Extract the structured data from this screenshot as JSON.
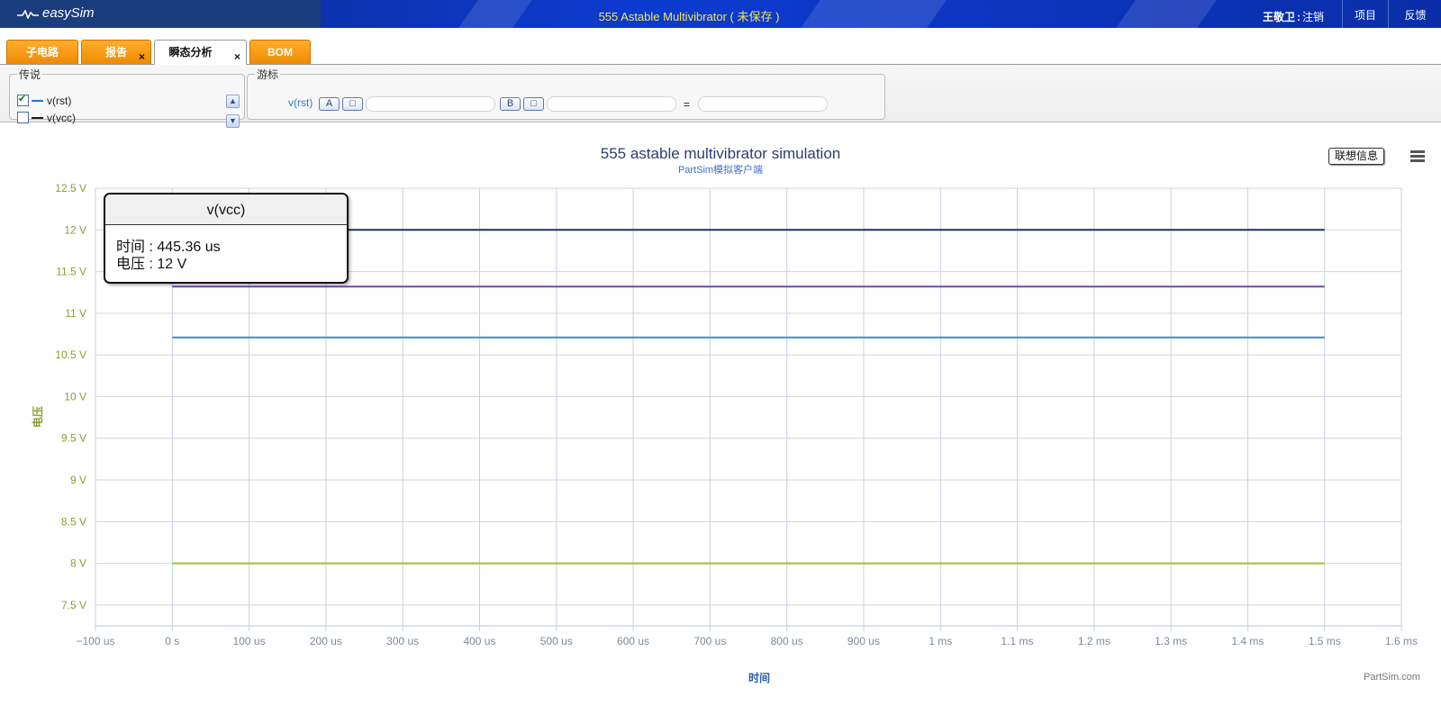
{
  "header": {
    "app_name": "easySim",
    "title": "555 Astable Multivibrator ( 未保存 )",
    "user_name": "王敬卫",
    "user_sep": ":",
    "logout": "注销",
    "projects": "项目",
    "feedback": "反馈"
  },
  "tabs": [
    {
      "label": "子电路",
      "closable": false,
      "active": false
    },
    {
      "label": "报告",
      "closable": true,
      "active": false
    },
    {
      "label": "瞬态分析",
      "closable": true,
      "active": true
    },
    {
      "label": "BOM",
      "closable": false,
      "active": false
    }
  ],
  "tab_close_glyph": "×",
  "legend_panel": {
    "title": "传说",
    "items": [
      {
        "label": "v(rst)",
        "checked": true,
        "color": "#2b6ed0"
      },
      {
        "label": "v(vcc)",
        "checked": false,
        "color": "#1a1a1a"
      }
    ]
  },
  "cursor_panel": {
    "title": "游标",
    "signal": "v(rst)",
    "a_button": "A",
    "b_button": "B",
    "small_button": "□",
    "equals": "=",
    "a_value": "",
    "b_value": "",
    "diff_value": ""
  },
  "chart_data": {
    "type": "line",
    "title": "555 astable multivibrator simulation",
    "subtitle": "PartSim模拟客户端",
    "xlabel": "时间",
    "ylabel": "电压",
    "xlim": [
      -100,
      1600
    ],
    "ylim": [
      7.25,
      12.5
    ],
    "x_ticks": [
      {
        "v": -100,
        "label": "−100 us"
      },
      {
        "v": 0,
        "label": "0 s"
      },
      {
        "v": 100,
        "label": "100 us"
      },
      {
        "v": 200,
        "label": "200 us"
      },
      {
        "v": 300,
        "label": "300 us"
      },
      {
        "v": 400,
        "label": "400 us"
      },
      {
        "v": 500,
        "label": "500 us"
      },
      {
        "v": 600,
        "label": "600 us"
      },
      {
        "v": 700,
        "label": "700 us"
      },
      {
        "v": 800,
        "label": "800 us"
      },
      {
        "v": 900,
        "label": "900 us"
      },
      {
        "v": 1000,
        "label": "1 ms"
      },
      {
        "v": 1100,
        "label": "1.1 ms"
      },
      {
        "v": 1200,
        "label": "1.2 ms"
      },
      {
        "v": 1300,
        "label": "1.3 ms"
      },
      {
        "v": 1400,
        "label": "1.4 ms"
      },
      {
        "v": 1500,
        "label": "1.5 ms"
      },
      {
        "v": 1600,
        "label": "1.6 ms"
      }
    ],
    "y_ticks": [
      {
        "v": 12.5,
        "label": "12.5 V"
      },
      {
        "v": 12,
        "label": "12 V"
      },
      {
        "v": 11.5,
        "label": "11.5 V"
      },
      {
        "v": 11,
        "label": "11 V"
      },
      {
        "v": 10.5,
        "label": "10.5 V"
      },
      {
        "v": 10,
        "label": "10 V"
      },
      {
        "v": 9.5,
        "label": "9.5 V"
      },
      {
        "v": 9,
        "label": "9 V"
      },
      {
        "v": 8.5,
        "label": "8.5 V"
      },
      {
        "v": 8,
        "label": "8 V"
      },
      {
        "v": 7.5,
        "label": "7.5 V"
      }
    ],
    "grid": true,
    "series": [
      {
        "x": [
          0,
          1500
        ],
        "y": [
          12,
          12
        ],
        "color": "#1f2f6b"
      },
      {
        "x": [
          0,
          1500
        ],
        "y": [
          11.32,
          11.32
        ],
        "color": "#6b4fa3"
      },
      {
        "x": [
          0,
          1500
        ],
        "y": [
          10.71,
          10.71
        ],
        "color": "#3a8fc8"
      },
      {
        "x": [
          0,
          1500
        ],
        "y": [
          8.0,
          8.0
        ],
        "color": "#9bc42a"
      }
    ],
    "tooltip": {
      "series": "v(vcc)",
      "time_label": "时间",
      "time_value": "445.36 us",
      "voltage_label": "电压",
      "voltage_value": "12 V"
    }
  },
  "chart_controls": {
    "assoc_button": "联想信息"
  },
  "credit": "PartSim.com"
}
